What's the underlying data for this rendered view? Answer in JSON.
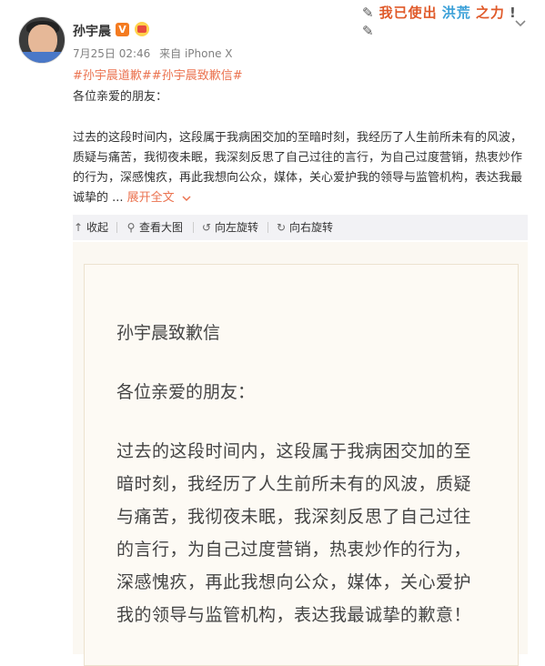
{
  "user": {
    "name": "孙宇晨",
    "verified_label": "V"
  },
  "meta": {
    "date": "7月25日 02:46",
    "source": "来自 iPhone X"
  },
  "banner": {
    "parts": [
      "✎",
      "我已使出",
      "洪荒",
      "之力",
      "!",
      "✎"
    ],
    "colors": [
      "#555555",
      "#e05a2a",
      "#3aa0d8",
      "#e05a2a",
      "#555555",
      "#555555"
    ]
  },
  "tags": [
    "#孙宇晨道歉#",
    "#孙宇晨致歉信#"
  ],
  "post": {
    "greeting": "各位亲爱的朋友：",
    "body": "过去的这段时间内，这段属于我病困交加的至暗时刻，我经历了人生前所未有的风波，质疑与痛苦，我彻夜未眠，我深刻反思了自己过往的言行，为自己过度营销，热衷炒作的行为，深感愧疚，再此我想向公众，媒体，关心爱护我的领导与监管机构，表达我最诚挚的 ... ",
    "expand_label": "展开全文",
    "expand_icon": "chevron-down"
  },
  "toolbar": {
    "items": [
      {
        "icon": "collapse",
        "label": "收起"
      },
      {
        "icon": "search",
        "label": "查看大图"
      },
      {
        "icon": "rotate-left",
        "label": "向左旋转"
      },
      {
        "icon": "rotate-right",
        "label": "向右旋转"
      }
    ]
  },
  "letter": {
    "title": "孙宇晨致歉信",
    "greeting": "各位亲爱的朋友：",
    "lines": [
      "过去的这段时间内，这段属于我病困交加的至",
      "暗时刻，我经历了人生前所未有的风波，质疑",
      "与痛苦，我彻夜未眠，我深刻反思了自己过往",
      "的言行，为自己过度营销，热衷炒作的行为，",
      "深感愧疚，再此我想向公众，媒体，关心爱护",
      "我的领导与监管机构，表达我最诚挚的歉意！"
    ]
  }
}
